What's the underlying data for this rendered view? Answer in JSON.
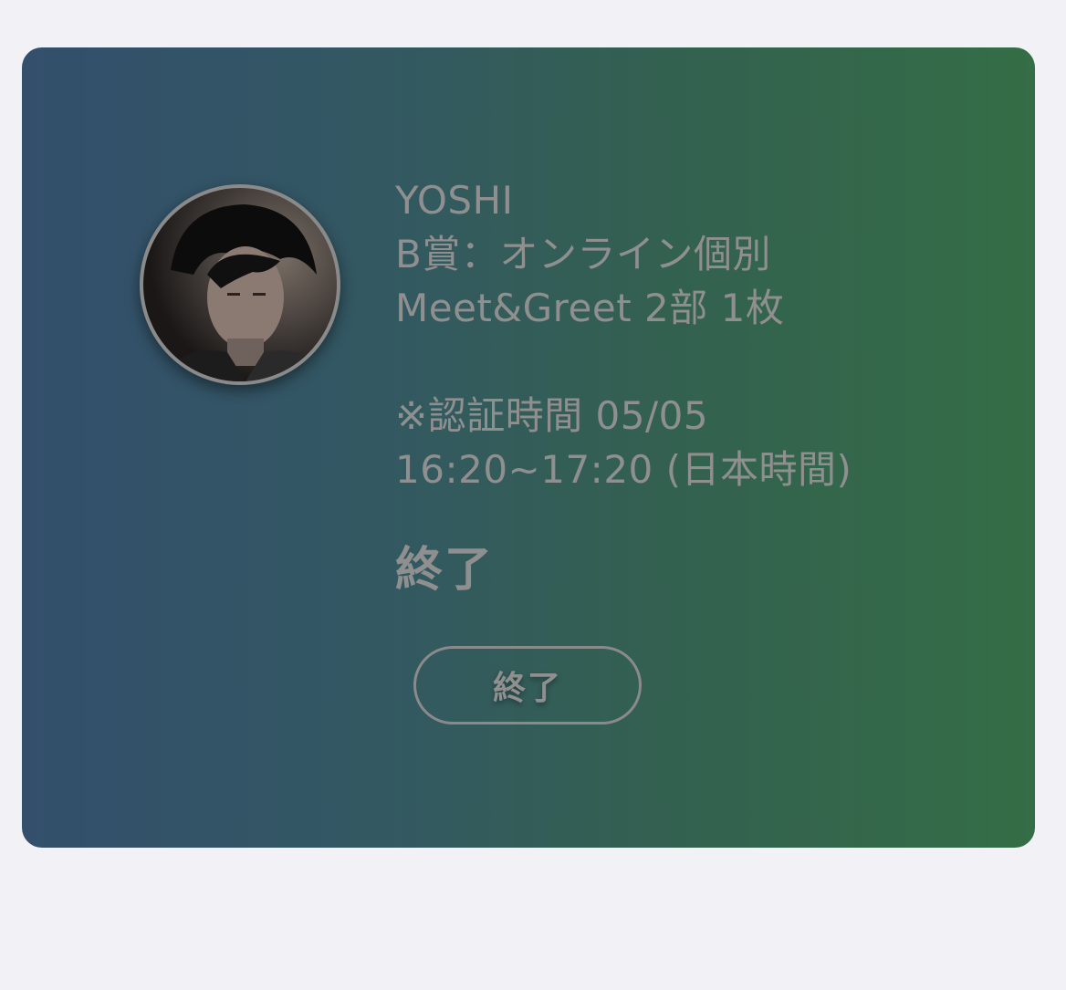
{
  "card": {
    "artist_name": "YOSHI",
    "prize_line1": "B賞：オンライン個別",
    "prize_line2": "Meet&Greet 2部 1枚",
    "auth_line1": "※認証時間 05/05",
    "auth_line2": "16:20~17:20 (日本時間)",
    "status": "終了",
    "button_label": "終了"
  },
  "colors": {
    "background": "#f2f1f6",
    "gradient_start": "#334f6c",
    "gradient_end": "#346d46",
    "text": "#8f8f8f"
  }
}
